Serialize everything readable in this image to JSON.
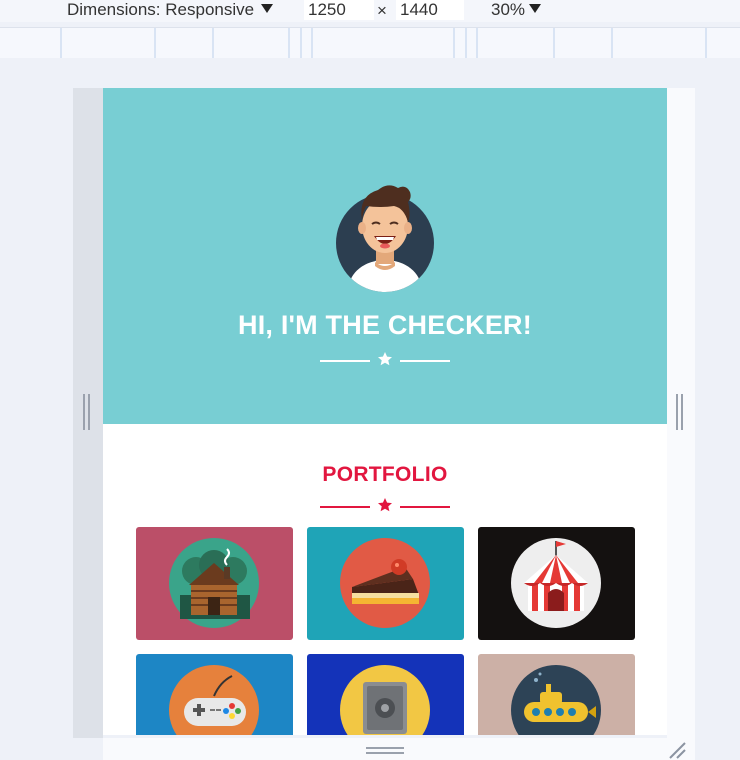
{
  "devtools": {
    "dimensions_label": "Dimensions: Responsive",
    "width_value": "1250",
    "height_value": "1440",
    "times_symbol": "×",
    "zoom_label": "30%"
  },
  "hero": {
    "background": "#78ced3",
    "title": "HI, I'M THE CHECKER!",
    "avatar": "smiling-man-avatar-icon",
    "divider_icon": "star-icon"
  },
  "portfolio": {
    "title": "PORTFOLIO",
    "accent": "#e2163f",
    "divider_icon": "star-icon",
    "items": [
      {
        "icon": "log-cabin-icon",
        "background": "#bb4f68"
      },
      {
        "icon": "cake-slice-icon",
        "background": "#1fa4b7"
      },
      {
        "icon": "circus-tent-icon",
        "background": "#141110"
      },
      {
        "icon": "game-controller-icon",
        "background": "#1d86c5"
      },
      {
        "icon": "safe-icon",
        "background": "#1433b9"
      },
      {
        "icon": "submarine-icon",
        "background": "#ccb0a6"
      }
    ]
  }
}
